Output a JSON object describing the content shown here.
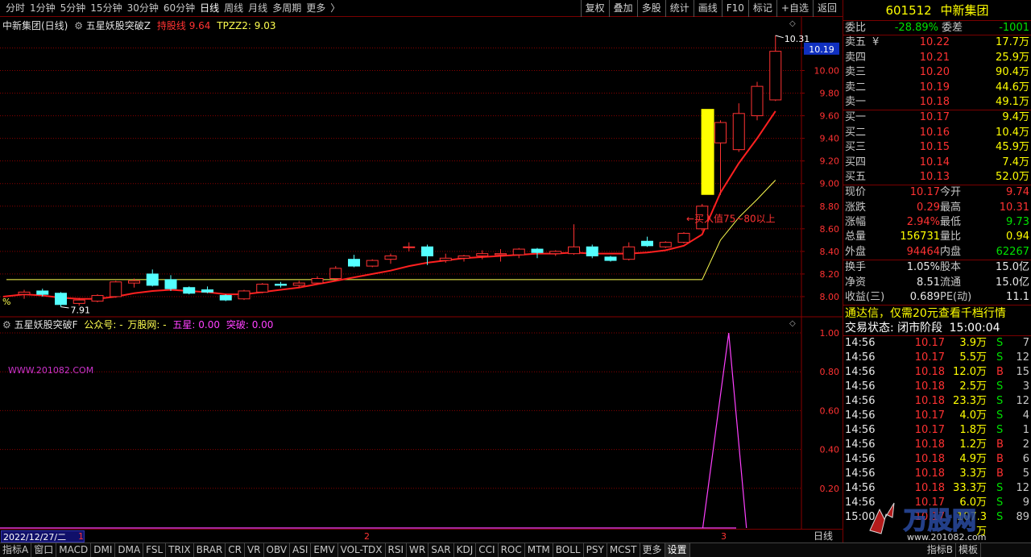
{
  "toolbar": {
    "periods": [
      "分时",
      "1分钟",
      "5分钟",
      "15分钟",
      "30分钟",
      "60分钟",
      "日线",
      "周线",
      "月线",
      "多周期",
      "更多"
    ],
    "active_period_index": 6,
    "more_arrow": "〉",
    "buttons": [
      "复权",
      "叠加",
      "多股",
      "统计",
      "画线",
      "F10",
      "标记",
      "+自选",
      "返回"
    ]
  },
  "main_pane": {
    "stock_label": "中新集团(日线)",
    "indicator_name": "五星妖股突破Z",
    "hold_label": "持股线",
    "hold_value": "9.64",
    "tpzz2_label": "TPZZ2:",
    "tpzz2_value": "9.03",
    "percent_sign": "%",
    "high_marker": "10.31",
    "low_marker": "7.91",
    "current_price_tag": "10.19",
    "annotation": "←买入值75~80以上",
    "y_ticks": [
      "10.20",
      "10.00",
      "9.80",
      "9.60",
      "9.40",
      "9.20",
      "9.00",
      "8.80",
      "8.60",
      "8.40",
      "8.20",
      "8.00"
    ]
  },
  "sub_pane": {
    "indicator_name": "五星妖股突破F",
    "public_label": "公众号:",
    "public_value": "-",
    "site_label": "万股网:",
    "site_value": "-",
    "star_label": "五星:",
    "star_value": "0.00",
    "breakout_label": "突破:",
    "breakout_value": "0.00",
    "watermark_url": "WWW.201082.COM",
    "y_ticks": [
      "1.00",
      "0.80",
      "0.60",
      "0.40",
      "0.20"
    ]
  },
  "period_strip": {
    "date": "2022/12/27/二",
    "marks": [
      "1",
      "2",
      "3"
    ],
    "daily_label": "日线"
  },
  "tabs": [
    "指标A",
    "窗口",
    "MACD",
    "DMI",
    "DMA",
    "FSL",
    "TRIX",
    "BRAR",
    "CR",
    "VR",
    "OBV",
    "ASI",
    "EMV",
    "VOL-TDX",
    "RSI",
    "WR",
    "SAR",
    "KDJ",
    "CCI",
    "ROC",
    "MTM",
    "BOLL",
    "PSY",
    "MCST",
    "更多",
    "设置",
    "指标B",
    "模板"
  ],
  "selected_tab_index": 25,
  "quote": {
    "code": "601512",
    "name": "中新集团",
    "weibi_label": "委比",
    "weibi_value": "-28.89%",
    "weicha_label": "委差",
    "weicha_value": "-1001",
    "yen": "¥",
    "asks": [
      {
        "label": "卖五",
        "price": "10.22",
        "vol": "17.7万"
      },
      {
        "label": "卖四",
        "price": "10.21",
        "vol": "25.9万"
      },
      {
        "label": "卖三",
        "price": "10.20",
        "vol": "90.4万"
      },
      {
        "label": "卖二",
        "price": "10.19",
        "vol": "44.6万"
      },
      {
        "label": "卖一",
        "price": "10.18",
        "vol": "49.1万"
      }
    ],
    "bids": [
      {
        "label": "买一",
        "price": "10.17",
        "vol": "9.4万"
      },
      {
        "label": "买二",
        "price": "10.16",
        "vol": "10.4万"
      },
      {
        "label": "买三",
        "price": "10.15",
        "vol": "45.9万"
      },
      {
        "label": "买四",
        "price": "10.14",
        "vol": "7.4万"
      },
      {
        "label": "买五",
        "price": "10.13",
        "vol": "52.0万"
      }
    ],
    "stats": [
      {
        "l1": "现价",
        "v1": "10.17",
        "l2": "今开",
        "v2": "9.74",
        "c1": "red",
        "c2": "red"
      },
      {
        "l1": "涨跌",
        "v1": "0.29",
        "l2": "最高",
        "v2": "10.31",
        "c1": "red",
        "c2": "red"
      },
      {
        "l1": "涨幅",
        "v1": "2.94%",
        "l2": "最低",
        "v2": "9.73",
        "c1": "red",
        "c2": "green"
      },
      {
        "l1": "总量",
        "v1": "156731",
        "l2": "量比",
        "v2": "0.94",
        "c1": "yellow",
        "c2": "yellow"
      },
      {
        "l1": "外盘",
        "v1": "94464",
        "l2": "内盘",
        "v2": "62267",
        "c1": "red",
        "c2": "green"
      }
    ],
    "fundamentals": [
      {
        "l1": "换手",
        "v1": "1.05%",
        "l2": "股本",
        "v2": "15.0亿"
      },
      {
        "l1": "净资",
        "v1": "8.51",
        "l2": "流通",
        "v2": "15.0亿"
      },
      {
        "l1": "收益(三)",
        "v1": "0.689",
        "l2": "PE(动)",
        "v2": "11.1"
      }
    ],
    "ad_text": "通达信，仅需20元查看千档行情",
    "trade_state_label": "交易状态:",
    "trade_state_value": "闭市阶段",
    "trade_state_time": "15:00:04"
  },
  "ticks": [
    {
      "time": "14:56",
      "price": "10.17",
      "vol": "3.9万",
      "bs": "S",
      "n": "7"
    },
    {
      "time": "14:56",
      "price": "10.17",
      "vol": "5.5万",
      "bs": "S",
      "n": "12"
    },
    {
      "time": "14:56",
      "price": "10.18",
      "vol": "12.0万",
      "bs": "B",
      "n": "15"
    },
    {
      "time": "14:56",
      "price": "10.18",
      "vol": "2.5万",
      "bs": "S",
      "n": "3"
    },
    {
      "time": "14:56",
      "price": "10.18",
      "vol": "23.3万",
      "bs": "S",
      "n": "12"
    },
    {
      "time": "14:56",
      "price": "10.17",
      "vol": "4.0万",
      "bs": "S",
      "n": "4"
    },
    {
      "time": "14:56",
      "price": "10.17",
      "vol": "1.8万",
      "bs": "S",
      "n": "1"
    },
    {
      "time": "14:56",
      "price": "10.18",
      "vol": "1.2万",
      "bs": "B",
      "n": "2"
    },
    {
      "time": "14:56",
      "price": "10.18",
      "vol": "4.9万",
      "bs": "B",
      "n": "6"
    },
    {
      "time": "14:56",
      "price": "10.18",
      "vol": "3.3万",
      "bs": "B",
      "n": "5"
    },
    {
      "time": "14:56",
      "price": "10.18",
      "vol": "33.3万",
      "bs": "S",
      "n": "12"
    },
    {
      "time": "14:56",
      "price": "10.17",
      "vol": "6.0万",
      "bs": "S",
      "n": "9"
    },
    {
      "time": "15:00",
      "price": "10.17",
      "vol": "107.3万",
      "bs": "S",
      "n": "89"
    }
  ],
  "watermark": {
    "brand": "万股网",
    "url": "www.201082.com"
  },
  "colors": {
    "up": "#ff3232",
    "down": "#54ffff",
    "ma_red": "#ff2020",
    "ma_yellow": "#ffff50",
    "signal_bar": "#ffff00",
    "spike": "#ff40ff",
    "grid": "#8a0000"
  },
  "chart_data": {
    "type": "candlestick",
    "ylim": [
      7.85,
      10.36
    ],
    "candles": [
      {
        "o": 8.02,
        "h": 8.06,
        "l": 7.98,
        "c": 8.04,
        "up": true
      },
      {
        "o": 8.05,
        "h": 8.07,
        "l": 8.0,
        "c": 8.02,
        "up": false
      },
      {
        "o": 8.03,
        "h": 8.04,
        "l": 7.91,
        "c": 7.93,
        "up": false
      },
      {
        "o": 7.94,
        "h": 7.99,
        "l": 7.92,
        "c": 7.97,
        "up": true
      },
      {
        "o": 7.96,
        "h": 8.02,
        "l": 7.95,
        "c": 8.01,
        "up": true
      },
      {
        "o": 8.0,
        "h": 8.14,
        "l": 7.99,
        "c": 8.13,
        "up": true
      },
      {
        "o": 8.12,
        "h": 8.16,
        "l": 8.08,
        "c": 8.14,
        "up": true
      },
      {
        "o": 8.2,
        "h": 8.24,
        "l": 8.09,
        "c": 8.1,
        "up": false
      },
      {
        "o": 8.15,
        "h": 8.19,
        "l": 8.05,
        "c": 8.07,
        "up": false
      },
      {
        "o": 8.08,
        "h": 8.09,
        "l": 8.02,
        "c": 8.03,
        "up": false
      },
      {
        "o": 8.06,
        "h": 8.09,
        "l": 8.03,
        "c": 8.04,
        "up": false
      },
      {
        "o": 8.01,
        "h": 8.02,
        "l": 7.96,
        "c": 7.97,
        "up": false
      },
      {
        "o": 7.98,
        "h": 8.06,
        "l": 7.97,
        "c": 8.05,
        "up": true
      },
      {
        "o": 8.04,
        "h": 8.12,
        "l": 8.03,
        "c": 8.11,
        "up": true
      },
      {
        "o": 8.11,
        "h": 8.13,
        "l": 8.08,
        "c": 8.1,
        "up": false
      },
      {
        "o": 8.1,
        "h": 8.14,
        "l": 8.08,
        "c": 8.12,
        "up": true
      },
      {
        "o": 8.12,
        "h": 8.18,
        "l": 8.11,
        "c": 8.16,
        "up": true
      },
      {
        "o": 8.16,
        "h": 8.27,
        "l": 8.15,
        "c": 8.25,
        "up": true
      },
      {
        "o": 8.27,
        "h": 8.37,
        "l": 8.26,
        "c": 8.33,
        "up": false
      },
      {
        "o": 8.27,
        "h": 8.33,
        "l": 8.26,
        "c": 8.32,
        "up": true
      },
      {
        "o": 8.33,
        "h": 8.38,
        "l": 8.29,
        "c": 8.36,
        "up": true
      },
      {
        "o": 8.44,
        "h": 8.48,
        "l": 8.4,
        "c": 8.44,
        "up": true
      },
      {
        "o": 8.44,
        "h": 8.46,
        "l": 8.28,
        "c": 8.36,
        "up": false
      },
      {
        "o": 8.34,
        "h": 8.38,
        "l": 8.3,
        "c": 8.32,
        "up": true
      },
      {
        "o": 8.34,
        "h": 8.37,
        "l": 8.31,
        "c": 8.36,
        "up": true
      },
      {
        "o": 8.36,
        "h": 8.41,
        "l": 8.33,
        "c": 8.38,
        "up": true
      },
      {
        "o": 8.38,
        "h": 8.42,
        "l": 8.31,
        "c": 8.37,
        "up": true
      },
      {
        "o": 8.37,
        "h": 8.43,
        "l": 8.34,
        "c": 8.42,
        "up": true
      },
      {
        "o": 8.42,
        "h": 8.43,
        "l": 8.34,
        "c": 8.39,
        "up": false
      },
      {
        "o": 8.38,
        "h": 8.41,
        "l": 8.36,
        "c": 8.4,
        "up": true
      },
      {
        "o": 8.38,
        "h": 8.64,
        "l": 8.37,
        "c": 8.44,
        "up": true
      },
      {
        "o": 8.44,
        "h": 8.46,
        "l": 8.34,
        "c": 8.36,
        "up": false
      },
      {
        "o": 8.35,
        "h": 8.36,
        "l": 8.31,
        "c": 8.32,
        "up": false
      },
      {
        "o": 8.33,
        "h": 8.48,
        "l": 8.32,
        "c": 8.44,
        "up": true
      },
      {
        "o": 8.49,
        "h": 8.53,
        "l": 8.44,
        "c": 8.45,
        "up": false
      },
      {
        "o": 8.44,
        "h": 8.49,
        "l": 8.43,
        "c": 8.48,
        "up": true
      },
      {
        "o": 8.48,
        "h": 8.57,
        "l": 8.47,
        "c": 8.56,
        "up": true
      },
      {
        "o": 8.6,
        "h": 8.82,
        "l": 8.58,
        "c": 8.8,
        "up": true
      },
      {
        "o": 9.36,
        "h": 9.56,
        "l": 8.9,
        "c": 9.54,
        "up": true
      },
      {
        "o": 9.3,
        "h": 9.71,
        "l": 9.28,
        "c": 9.62,
        "up": true
      },
      {
        "o": 9.6,
        "h": 9.9,
        "l": 9.56,
        "c": 9.86,
        "up": true
      },
      {
        "o": 9.74,
        "h": 10.31,
        "l": 9.73,
        "c": 10.17,
        "up": true
      }
    ],
    "ma_red": [
      8.02,
      8.01,
      7.99,
      7.98,
      7.98,
      8.0,
      8.03,
      8.05,
      8.06,
      8.05,
      8.04,
      8.02,
      8.02,
      8.04,
      8.06,
      8.08,
      8.11,
      8.14,
      8.17,
      8.2,
      8.23,
      8.27,
      8.3,
      8.32,
      8.34,
      8.35,
      8.36,
      8.37,
      8.38,
      8.38,
      8.39,
      8.38,
      8.38,
      8.38,
      8.39,
      8.41,
      8.45,
      8.55,
      8.92,
      9.18,
      9.4,
      9.64
    ],
    "ma_yellow": [
      8.15,
      8.15,
      8.15,
      8.15,
      8.15,
      8.15,
      8.15,
      8.15,
      8.15,
      8.15,
      8.15,
      8.15,
      8.15,
      8.15,
      8.15,
      8.15,
      8.15,
      8.15,
      8.15,
      8.15,
      8.15,
      8.15,
      8.15,
      8.15,
      8.15,
      8.15,
      8.15,
      8.15,
      8.15,
      8.15,
      8.15,
      8.15,
      8.15,
      8.15,
      8.15,
      8.15,
      8.15,
      8.15,
      8.5,
      8.7,
      8.86,
      9.03
    ],
    "signal_bar": {
      "index": 37.3,
      "low": 8.9,
      "high": 9.66
    },
    "sub_ylim": [
      0,
      1.05
    ],
    "sub_values": [
      0,
      0,
      0,
      0,
      0,
      0,
      0,
      0,
      0,
      0,
      0,
      0,
      0,
      0,
      0,
      0,
      0,
      0,
      0,
      0,
      0,
      0,
      0,
      0,
      0,
      0,
      0,
      0,
      0,
      0,
      0,
      0,
      0,
      0,
      0,
      0,
      0,
      0,
      1.0,
      0,
      0,
      0
    ]
  }
}
